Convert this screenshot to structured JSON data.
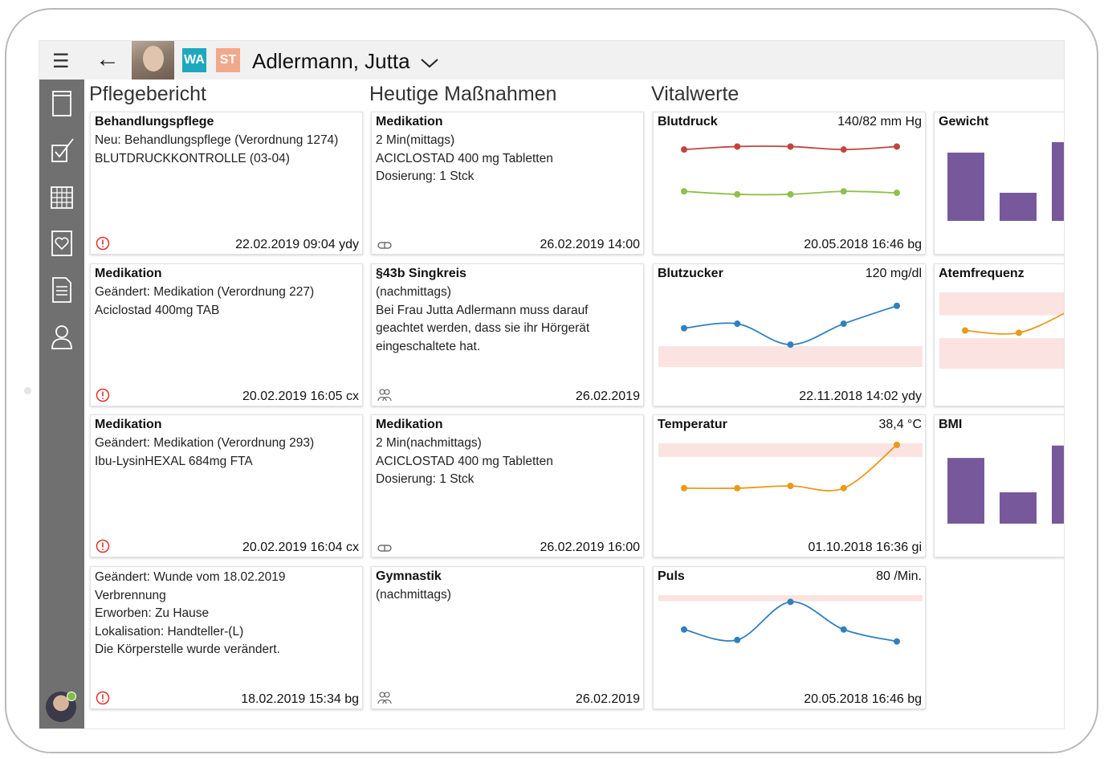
{
  "header": {
    "patient_name": "Adlermann, Jutta",
    "tag_wa": "WA",
    "tag_st": "ST"
  },
  "icons": {
    "menu": "hamburger-menu-icon",
    "back": "arrow-left-icon",
    "dropdown": "chevron-down-icon",
    "sidebar": [
      "book-icon",
      "checklist-icon",
      "calendar-icon",
      "heart-document-icon",
      "document-icon",
      "person-icon"
    ],
    "alert": "exclamation-circle-icon",
    "pill": "pill-icon",
    "group": "group-icon"
  },
  "colors": {
    "wa": "#1ea8bd",
    "st": "#f2a88a",
    "sidebar": "#707070",
    "bar": "#77599b",
    "line_blue": "#2f80c0",
    "line_red": "#c0463d",
    "line_green": "#8fc04a",
    "line_orange": "#e89a1a",
    "range": "#fbe3e1"
  },
  "columns": {
    "report": "Pflegebericht",
    "measures": "Heutige Maßnahmen",
    "vitals": "Vitalwerte"
  },
  "report": [
    {
      "title": "Behandlungspflege",
      "lines": [
        "Neu: Behandlungspflege (Verordnung 1274)",
        "BLUTDRUCKKONTROLLE (03-04)"
      ],
      "footer": "22.02.2019 09:04 ydy"
    },
    {
      "title": "Medikation",
      "lines": [
        "Geändert: Medikation (Verordnung 227)",
        "Aciclostad 400mg TAB"
      ],
      "footer": "20.02.2019 16:05 cx"
    },
    {
      "title": "Medikation",
      "lines": [
        "Geändert: Medikation (Verordnung 293)",
        "Ibu-LysinHEXAL 684mg FTA"
      ],
      "footer": "20.02.2019 16:04 cx"
    },
    {
      "title": "",
      "lines": [
        "Geändert: Wunde vom 18.02.2019",
        "Verbrennung",
        "Erworben: Zu Hause",
        "Lokalisation: Handteller-(L)",
        "Die Körperstelle wurde verändert."
      ],
      "footer": "18.02.2019 15:34 bg"
    }
  ],
  "measures": [
    {
      "title": "Medikation",
      "lines": [
        "2 Min(mittags)",
        "ACICLOSTAD 400 mg Tabletten",
        "Dosierung: 1 Stck"
      ],
      "footer": "26.02.2019 14:00"
    },
    {
      "title": "§43b Singkreis",
      "lines": [
        "(nachmittags)",
        "Bei Frau Jutta Adlermann muss darauf",
        "geachtet werden, dass sie ihr Hörgerät",
        "eingeschaltete hat."
      ],
      "footer": "26.02.2019"
    },
    {
      "title": "Medikation",
      "lines": [
        "2 Min(nachmittags)",
        "ACICLOSTAD 400 mg Tabletten",
        "Dosierung: 1 Stck"
      ],
      "footer": "26.02.2019 16:00"
    },
    {
      "title": "Gymnastik",
      "lines": [
        "(nachmittags)"
      ],
      "footer": "26.02.2019"
    }
  ],
  "vitals": [
    {
      "title": "Blutdruck",
      "value": "140/82 mm Hg",
      "footer": "20.05.2018 16:46 bg"
    },
    {
      "title": "Blutzucker",
      "value": "120 mg/dl",
      "footer": "22.11.2018 14:02 ydy"
    },
    {
      "title": "Temperatur",
      "value": "38,4 °C",
      "footer": "01.10.2018 16:36 gi"
    },
    {
      "title": "Puls",
      "value": "80 /Min.",
      "footer": "20.05.2018 16:46 bg"
    }
  ],
  "vitals_side": [
    {
      "title": "Gewicht"
    },
    {
      "title": "Atemfrequenz"
    },
    {
      "title": "BMI"
    }
  ],
  "chart_data": [
    {
      "type": "line",
      "title": "Blutdruck",
      "series": [
        {
          "values": [
            6,
            4,
            4,
            6,
            4
          ]
        },
        {
          "values": [
            34,
            36,
            36,
            34,
            35
          ]
        }
      ],
      "ylim": [
        0,
        50
      ],
      "grid": false
    },
    {
      "type": "line",
      "title": "Blutzucker",
      "series": [
        {
          "values": [
            48,
            42,
            70,
            42,
            18
          ]
        }
      ],
      "range_band": [
        72,
        100
      ],
      "ylim": [
        0,
        100
      ],
      "grid": false
    },
    {
      "type": "line",
      "title": "Temperatur",
      "series": [
        {
          "values": [
            60,
            60,
            57,
            60,
            2
          ]
        }
      ],
      "range_band": [
        0,
        18
      ],
      "ylim": [
        0,
        100
      ],
      "grid": false
    },
    {
      "type": "line",
      "title": "Puls",
      "series": [
        {
          "values": [
            46,
            60,
            9,
            46,
            62
          ]
        }
      ],
      "range_band": [
        0,
        8
      ],
      "ylim": [
        0,
        100
      ],
      "grid": false
    },
    {
      "type": "bar",
      "title": "Gewicht",
      "values": [
        85,
        35,
        98
      ],
      "ylim": [
        0,
        100
      ],
      "grid": false
    },
    {
      "type": "line",
      "title": "Atemfrequenz",
      "series": [
        {
          "values": [
            50,
            53,
            22
          ]
        }
      ],
      "range_band": [
        [
          0,
          30
        ],
        [
          60,
          100
        ]
      ],
      "ylim": [
        0,
        100
      ],
      "grid": false
    },
    {
      "type": "bar",
      "title": "BMI",
      "values": [
        90,
        43,
        107
      ],
      "ylim": [
        0,
        110
      ],
      "grid": false
    }
  ]
}
